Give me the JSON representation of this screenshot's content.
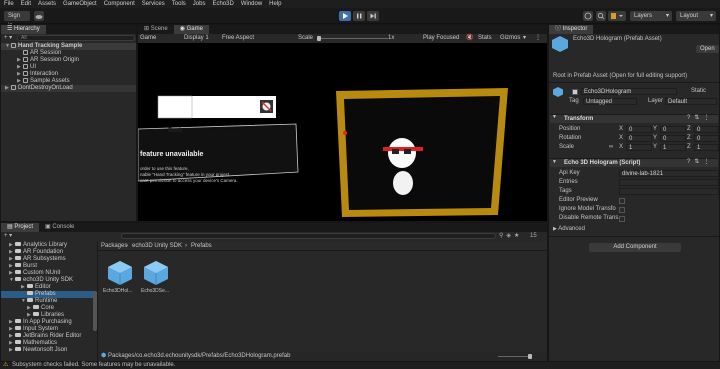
{
  "menu": [
    "File",
    "Edit",
    "Assets",
    "GameObject",
    "Component",
    "Services",
    "Tools",
    "Jobs",
    "Echo3D",
    "Window",
    "Help"
  ],
  "toolbar": {
    "sign_in": "Sign in",
    "layers": "Layers",
    "layout": "Layout"
  },
  "hierarchy": {
    "tab": "Hierarchy",
    "search_prefix": "All",
    "items": [
      {
        "label": "Hand Tracking Sample",
        "depth": 0
      },
      {
        "label": "AR Session",
        "depth": 1
      },
      {
        "label": "AR Session Origin",
        "depth": 1
      },
      {
        "label": "UI",
        "depth": 1
      },
      {
        "label": "Interaction",
        "depth": 1
      },
      {
        "label": "Sample Assets",
        "depth": 1
      },
      {
        "label": "DontDestroyOnLoad",
        "depth": 0
      }
    ]
  },
  "scene": {
    "tabs": [
      "Scene",
      "Game"
    ],
    "game_toolbar": {
      "display_mode": "Game",
      "display": "Display 1",
      "aspect": "Free Aspect",
      "scale_label": "Scale",
      "scale_value": "1x",
      "play_mode": "Play Focused",
      "stats": "Stats",
      "gizmos": "Gizmos"
    },
    "ui_back": "Back",
    "ui_title": "Hand Tracking",
    "dialog_title": "feature unavailable",
    "dialog_body": "order to use this feature,\nnable \"Hand Tracking\" feature in your project\ncant permission to access your device's Camera."
  },
  "project": {
    "tabs": [
      "Project",
      "Console"
    ],
    "tree": [
      {
        "label": "Analytics Library",
        "depth": 1
      },
      {
        "label": "AR Foundation",
        "depth": 1
      },
      {
        "label": "AR Subsystems",
        "depth": 1
      },
      {
        "label": "Burst",
        "depth": 1
      },
      {
        "label": "Custom NUnit",
        "depth": 1
      },
      {
        "label": "echo3D Unity SDK",
        "depth": 1
      },
      {
        "label": "Editor",
        "depth": 2
      },
      {
        "label": "Prefabs",
        "depth": 2
      },
      {
        "label": "Runtime",
        "depth": 2
      },
      {
        "label": "Core",
        "depth": 3
      },
      {
        "label": "Libraries",
        "depth": 3
      },
      {
        "label": "In App Purchasing",
        "depth": 1
      },
      {
        "label": "Input System",
        "depth": 1
      },
      {
        "label": "JetBrains Rider Editor",
        "depth": 1
      },
      {
        "label": "Mathematics",
        "depth": 1
      },
      {
        "label": "Newtonsoft Json",
        "depth": 1
      }
    ],
    "breadcrumb": [
      "Packages",
      "echo3D Unity SDK",
      "Prefabs"
    ],
    "assets": [
      "Echo3DHol...",
      "Echo3DSe..."
    ],
    "path": "Packages/co.echo3d.echounitysdk/Prefabs/Echo3DHologram.prefab",
    "count": "15"
  },
  "inspector": {
    "tab": "Inspector",
    "asset_title": "Echo3D Hologram (Prefab Asset)",
    "open_btn": "Open",
    "root_note": "Root in Prefab Asset (Open for full editing support)",
    "object_name": "Echo3DHologram",
    "static_label": "Static",
    "tag_label": "Tag",
    "tag_value": "Untagged",
    "layer_label": "Layer",
    "layer_value": "Default",
    "transform": {
      "title": "Transform",
      "rows": [
        {
          "label": "Position",
          "x": "0",
          "y": "0",
          "z": "0"
        },
        {
          "label": "Rotation",
          "x": "0",
          "y": "0",
          "z": "0"
        },
        {
          "label": "Scale",
          "x": "1",
          "y": "1",
          "z": "1"
        }
      ]
    },
    "script": {
      "title": "Echo 3D Hologram (Script)",
      "fields": [
        {
          "label": "Api Key",
          "value": "divine-lab-1821"
        },
        {
          "label": "Entries",
          "value": ""
        },
        {
          "label": "Tags",
          "value": ""
        },
        {
          "label": "Editor Preview",
          "value": ""
        },
        {
          "label": "Ignore Model Transfo",
          "value": ""
        },
        {
          "label": "Disable Remote Trans",
          "value": ""
        }
      ],
      "advanced": "Advanced"
    },
    "add_component": "Add Component"
  },
  "status_bar": "Subsystem checks failed. Some features may be unavailable."
}
